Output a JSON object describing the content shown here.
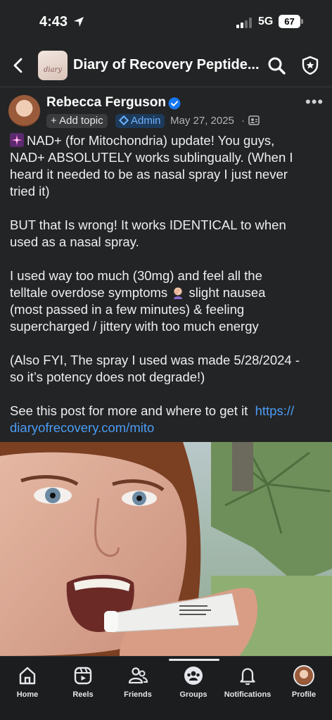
{
  "status_bar": {
    "time": "4:43",
    "network": "5G",
    "battery": "67"
  },
  "header": {
    "group_title": "Diary of Recovery Peptide...",
    "group_thumb_text": "diary"
  },
  "post": {
    "author": "Rebecca Ferguson",
    "add_topic": "+ Add topic",
    "admin_label": "Admin",
    "date": "May 27, 2025",
    "date_sep": "·",
    "body": {
      "p1": [
        "NAD+ (for Mitochondria) update! You guys,",
        "NAD+ ABSOLUTELY works sublingually. (When I",
        "heard it needed to be as nasal spray I just never",
        "tried it)"
      ],
      "p2": [
        "BUT that Is wrong! It works IDENTICAL to when",
        "used as a nasal spray."
      ],
      "p3": [
        "I used way too much (30mg) and feel all the",
        "telltale overdose symptoms",
        "slight nausea",
        "(most passed in a few minutes) & feeling",
        "supercharged / jittery with too much energy"
      ],
      "p4": [
        "(Also FYI, The spray I used was made 5/28/2024 -",
        "so it’s potency does not degrade!)"
      ],
      "p5": [
        "See this post for more and where to get it",
        "https://",
        "diaryofrecovery.com/mito"
      ]
    }
  },
  "nav": [
    {
      "label": "Home",
      "icon": "home-icon"
    },
    {
      "label": "Reels",
      "icon": "reels-icon"
    },
    {
      "label": "Friends",
      "icon": "friends-icon"
    },
    {
      "label": "Groups",
      "icon": "groups-icon"
    },
    {
      "label": "Notifications",
      "icon": "bell-icon"
    },
    {
      "label": "Profile",
      "icon": "profile-avatar"
    }
  ],
  "colors": {
    "background": "#232425",
    "link": "#4b9cf5",
    "admin_chip": "#1d3a5a",
    "verified": "#1877f2"
  }
}
